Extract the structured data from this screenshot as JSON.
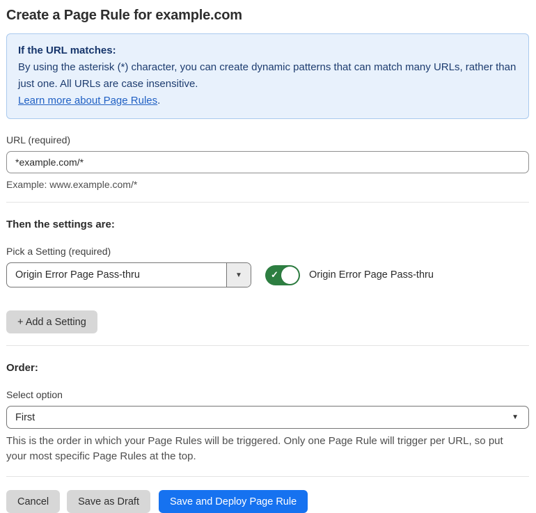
{
  "page": {
    "title": "Create a Page Rule for example.com"
  },
  "info_box": {
    "heading": "If the URL matches:",
    "body": "By using the asterisk (*) character, you can create dynamic patterns that can match many URLs, rather than just one. All URLs are case insensitive.",
    "link_label": "Learn more about Page Rules",
    "link_suffix": "."
  },
  "url_field": {
    "label": "URL (required)",
    "value": "*example.com/*",
    "helper": "Example: www.example.com/*"
  },
  "settings_section": {
    "heading": "Then the settings are:",
    "picker_label": "Pick a Setting (required)",
    "picker_value": "Origin Error Page Pass-thru",
    "toggle_state": "on",
    "toggle_label": "Origin Error Page Pass-thru",
    "add_button_label": "+ Add a Setting"
  },
  "order_section": {
    "heading": "Order:",
    "select_label": "Select option",
    "select_value": "First",
    "helper": "This is the order in which your Page Rules will be triggered. Only one Page Rule will trigger per URL, so put your most specific Page Rules at the top."
  },
  "footer": {
    "cancel_label": "Cancel",
    "save_draft_label": "Save as Draft",
    "save_deploy_label": "Save and Deploy Page Rule"
  },
  "icons": {
    "caret_down": "▼",
    "check": "✓"
  },
  "colors": {
    "accent_blue": "#1672f0",
    "toggle_green": "#2d7e41",
    "info_bg": "#e8f1fc",
    "info_border": "#a9c9ee",
    "info_text": "#1d3c6f",
    "link_blue": "#2161c4"
  }
}
